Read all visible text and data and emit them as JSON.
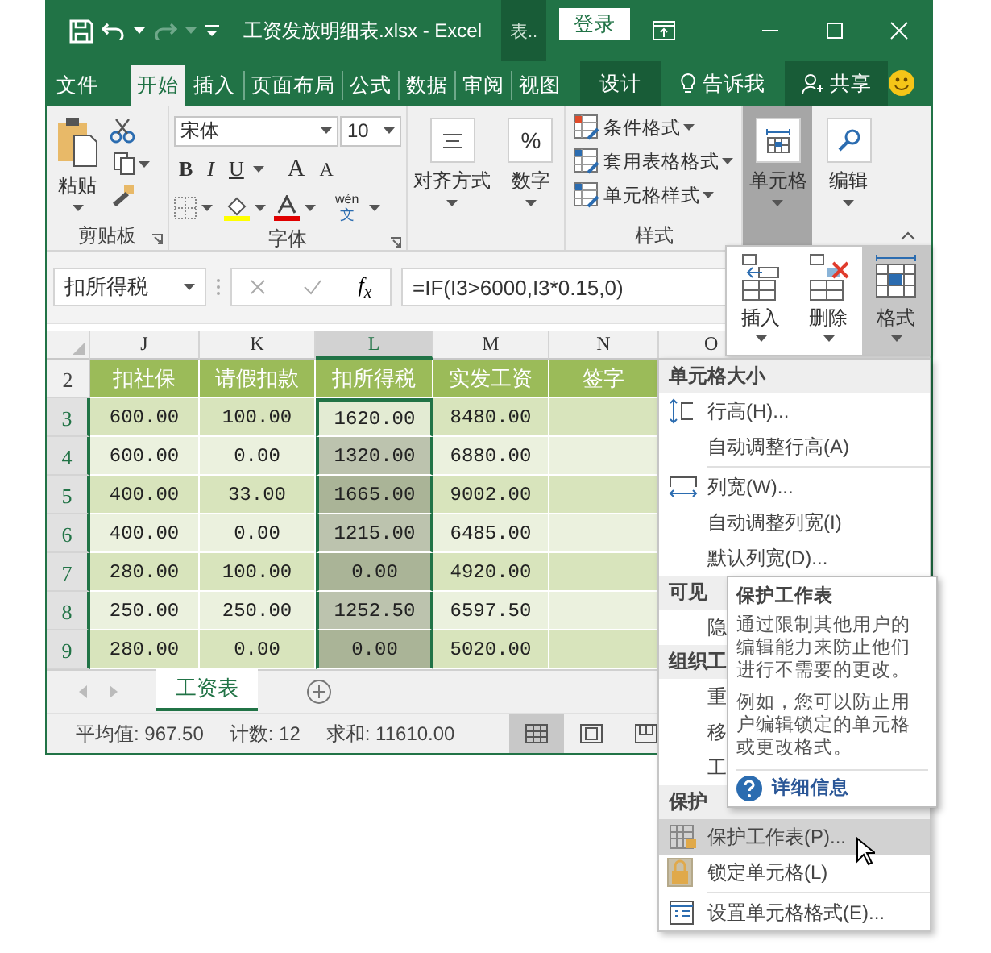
{
  "title_bar": {
    "title": "工资发放明细表.xlsx - Excel",
    "context_tab": "表..",
    "sign_in": "登录"
  },
  "tabs": [
    {
      "label": "文件",
      "kind": "file",
      "selected": false
    },
    {
      "label": "开始",
      "kind": "normal",
      "selected": true
    },
    {
      "label": "插入",
      "kind": "normal",
      "selected": false
    },
    {
      "label": "页面布局",
      "kind": "normal",
      "selected": false
    },
    {
      "label": "公式",
      "kind": "normal",
      "selected": false
    },
    {
      "label": "数据",
      "kind": "normal",
      "selected": false
    },
    {
      "label": "审阅",
      "kind": "normal",
      "selected": false
    },
    {
      "label": "视图",
      "kind": "normal",
      "selected": false
    },
    {
      "label": "设计",
      "kind": "context",
      "selected": false
    }
  ],
  "tell_me": "告诉我",
  "share": "共享",
  "ribbon": {
    "clipboard": {
      "paste": "粘贴",
      "label": "剪贴板"
    },
    "font": {
      "name": "宋体",
      "size": "10",
      "bold": "B",
      "italic": "I",
      "underline": "U",
      "grow": "A",
      "shrink": "A",
      "phonetic_top": "wén",
      "phonetic_bottom": "文",
      "label": "字体"
    },
    "alignment": "对齐方式",
    "number": "数字",
    "number_symbol": "%",
    "styles": {
      "items": [
        "条件格式",
        "套用表格格式",
        "单元格样式"
      ],
      "label": "样式"
    },
    "cells": {
      "label": "单元格",
      "selected": true
    },
    "editing": "编辑"
  },
  "formula_bar": {
    "name_box": "扣所得税",
    "insert_function": "f$_{x}$",
    "formula": "=IF(I3>6000,I3*0.15,0)"
  },
  "grid": {
    "columns": [
      {
        "label": "J",
        "selected": false
      },
      {
        "label": "K",
        "selected": false
      },
      {
        "label": "L",
        "selected": true
      },
      {
        "label": "M",
        "selected": false
      },
      {
        "label": "N",
        "selected": false
      },
      {
        "label": "O",
        "selected": false
      }
    ],
    "header_row": {
      "label": "2",
      "selected": false,
      "cells": [
        "扣社保",
        "请假扣款",
        "扣所得税",
        "实发工资",
        "签字"
      ]
    },
    "rows": [
      {
        "label": "3",
        "selected": true,
        "active": true,
        "cells": [
          "600.00",
          "100.00",
          "1620.00",
          "8480.00"
        ]
      },
      {
        "label": "4",
        "selected": true,
        "active": false,
        "cells": [
          "600.00",
          "0.00",
          "1320.00",
          "6880.00"
        ]
      },
      {
        "label": "5",
        "selected": true,
        "active": false,
        "cells": [
          "400.00",
          "33.00",
          "1665.00",
          "9002.00"
        ]
      },
      {
        "label": "6",
        "selected": true,
        "active": false,
        "cells": [
          "400.00",
          "0.00",
          "1215.00",
          "6485.00"
        ]
      },
      {
        "label": "7",
        "selected": true,
        "active": false,
        "cells": [
          "280.00",
          "100.00",
          "0.00",
          "4920.00"
        ]
      },
      {
        "label": "8",
        "selected": true,
        "active": false,
        "cells": [
          "250.00",
          "250.00",
          "1252.50",
          "6597.50"
        ]
      },
      {
        "label": "9",
        "selected": true,
        "active": false,
        "cells": [
          "280.00",
          "0.00",
          "0.00",
          "5020.00"
        ]
      }
    ]
  },
  "sheets": [
    {
      "label": "工资表",
      "selected": true
    }
  ],
  "status_bar": {
    "average": "平均值: 967.50",
    "count": "计数: 12",
    "sum": "求和: 11610.00",
    "views": [
      {
        "kind": "normal",
        "selected": true
      },
      {
        "kind": "page-layout",
        "selected": false
      },
      {
        "kind": "page-break",
        "selected": false
      }
    ]
  },
  "cells_popup": {
    "buttons": [
      {
        "label": "插入",
        "kind": "insert",
        "selected": false
      },
      {
        "label": "删除",
        "kind": "delete",
        "selected": false
      },
      {
        "label": "格式",
        "kind": "format",
        "selected": true
      }
    ]
  },
  "menu": {
    "entries": [
      {
        "kind": "header",
        "label": "单元格大小"
      },
      {
        "kind": "row-height",
        "label": "行高(H)...",
        "selected": false,
        "checked": false
      },
      {
        "kind": "plain",
        "label": "自动调整行高(A)",
        "selected": false,
        "checked": false
      },
      {
        "kind": "separator"
      },
      {
        "kind": "column-width",
        "label": "列宽(W)...",
        "selected": false,
        "checked": false
      },
      {
        "kind": "plain",
        "label": "自动调整列宽(I)",
        "selected": false,
        "checked": false
      },
      {
        "kind": "plain",
        "label": "默认列宽(D)...",
        "selected": false,
        "checked": false
      },
      {
        "kind": "header",
        "label": "可见"
      },
      {
        "kind": "plain",
        "label": "隐",
        "selected": false,
        "checked": false
      },
      {
        "kind": "header",
        "label": "组织工"
      },
      {
        "kind": "plain",
        "label": "重",
        "selected": false,
        "checked": false
      },
      {
        "kind": "plain",
        "label": "移",
        "selected": false,
        "checked": false
      },
      {
        "kind": "plain",
        "label": "工",
        "selected": false,
        "checked": false
      },
      {
        "kind": "header",
        "label": "保护"
      },
      {
        "kind": "protect",
        "label": "保护工作表(P)...",
        "selected": true,
        "checked": false
      },
      {
        "kind": "lock",
        "label": "锁定单元格(L)",
        "selected": false,
        "checked": true
      },
      {
        "kind": "separator"
      },
      {
        "kind": "format",
        "label": "设置单元格格式(E)...",
        "selected": false,
        "checked": false
      }
    ]
  },
  "tooltip": {
    "title": "保护工作表",
    "body": "通过限制其他用户的编辑能力来防止他们进行不需要的更改。",
    "example": "例如，您可以防止用户编辑锁定的单元格或更改格式。",
    "link": "详细信息"
  }
}
